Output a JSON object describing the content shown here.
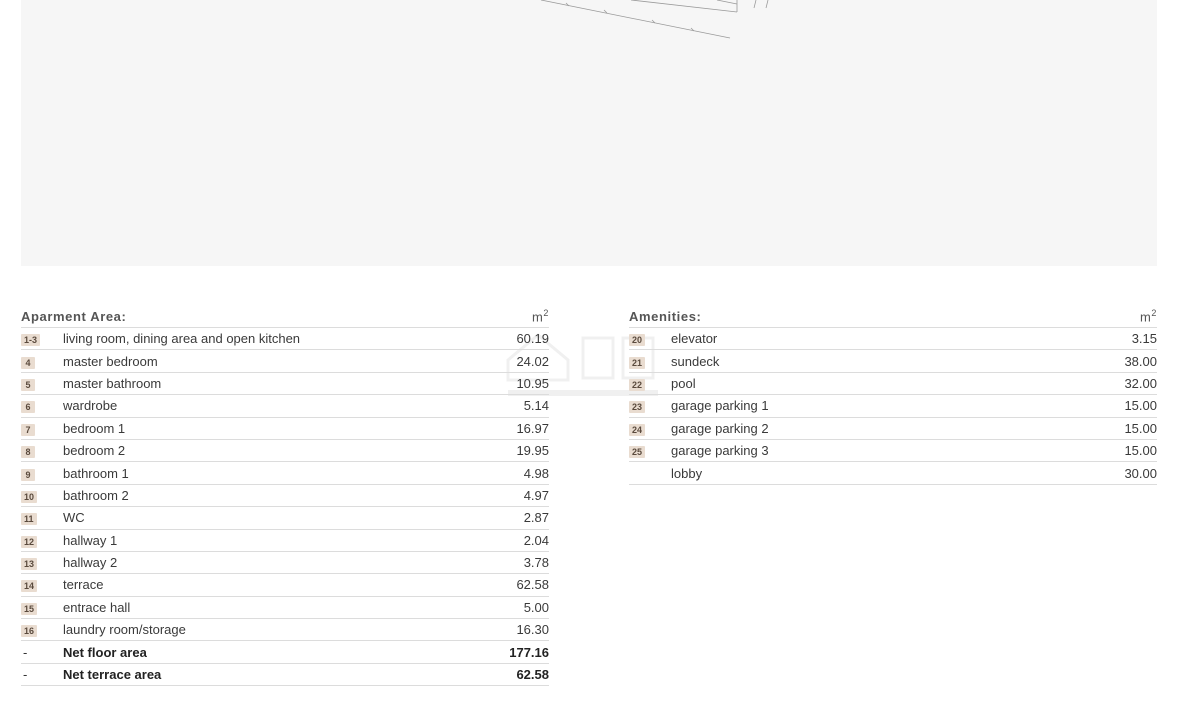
{
  "apartment": {
    "title": "Aparment Area:",
    "unit": "m",
    "unit_sup": "2",
    "rows": [
      {
        "num": "1-3",
        "label": "living room, dining area and open kitchen",
        "value": "60.19"
      },
      {
        "num": "4",
        "label": "master bedroom",
        "value": "24.02"
      },
      {
        "num": "5",
        "label": "master bathroom",
        "value": "10.95"
      },
      {
        "num": "6",
        "label": "wardrobe",
        "value": "5.14"
      },
      {
        "num": "7",
        "label": "bedroom 1",
        "value": "16.97"
      },
      {
        "num": "8",
        "label": "bedroom 2",
        "value": "19.95"
      },
      {
        "num": "9",
        "label": "bathroom 1",
        "value": "4.98"
      },
      {
        "num": "10",
        "label": "bathroom 2",
        "value": "4.97"
      },
      {
        "num": "11",
        "label": "WC",
        "value": "2.87"
      },
      {
        "num": "12",
        "label": "hallway 1",
        "value": "2.04"
      },
      {
        "num": "13",
        "label": "hallway 2",
        "value": "3.78"
      },
      {
        "num": "14",
        "label": "terrace",
        "value": "62.58"
      },
      {
        "num": "15",
        "label": "entrace hall",
        "value": "5.00"
      },
      {
        "num": "16",
        "label": "laundry room/storage",
        "value": "16.30"
      }
    ],
    "totals": [
      {
        "num": "-",
        "label": "Net floor area",
        "value": "177.16"
      },
      {
        "num": "-",
        "label": "Net terrace area",
        "value": "62.58"
      }
    ]
  },
  "amenities": {
    "title": "Amenities:",
    "unit": "m",
    "unit_sup": "2",
    "rows": [
      {
        "num": "20",
        "label": "elevator",
        "value": "3.15"
      },
      {
        "num": "21",
        "label": "sundeck",
        "value": "38.00"
      },
      {
        "num": "22",
        "label": "pool",
        "value": "32.00"
      },
      {
        "num": "23",
        "label": "garage parking 1",
        "value": "15.00"
      },
      {
        "num": "24",
        "label": "garage parking 2",
        "value": "15.00"
      },
      {
        "num": "25",
        "label": "garage parking 3",
        "value": "15.00"
      },
      {
        "num": "",
        "label": "lobby",
        "value": "30.00"
      }
    ]
  },
  "colors": {
    "badge_bg": "#e9dcd0",
    "plan_bg": "#f6f6f6",
    "rule": "#dcdcdc"
  }
}
